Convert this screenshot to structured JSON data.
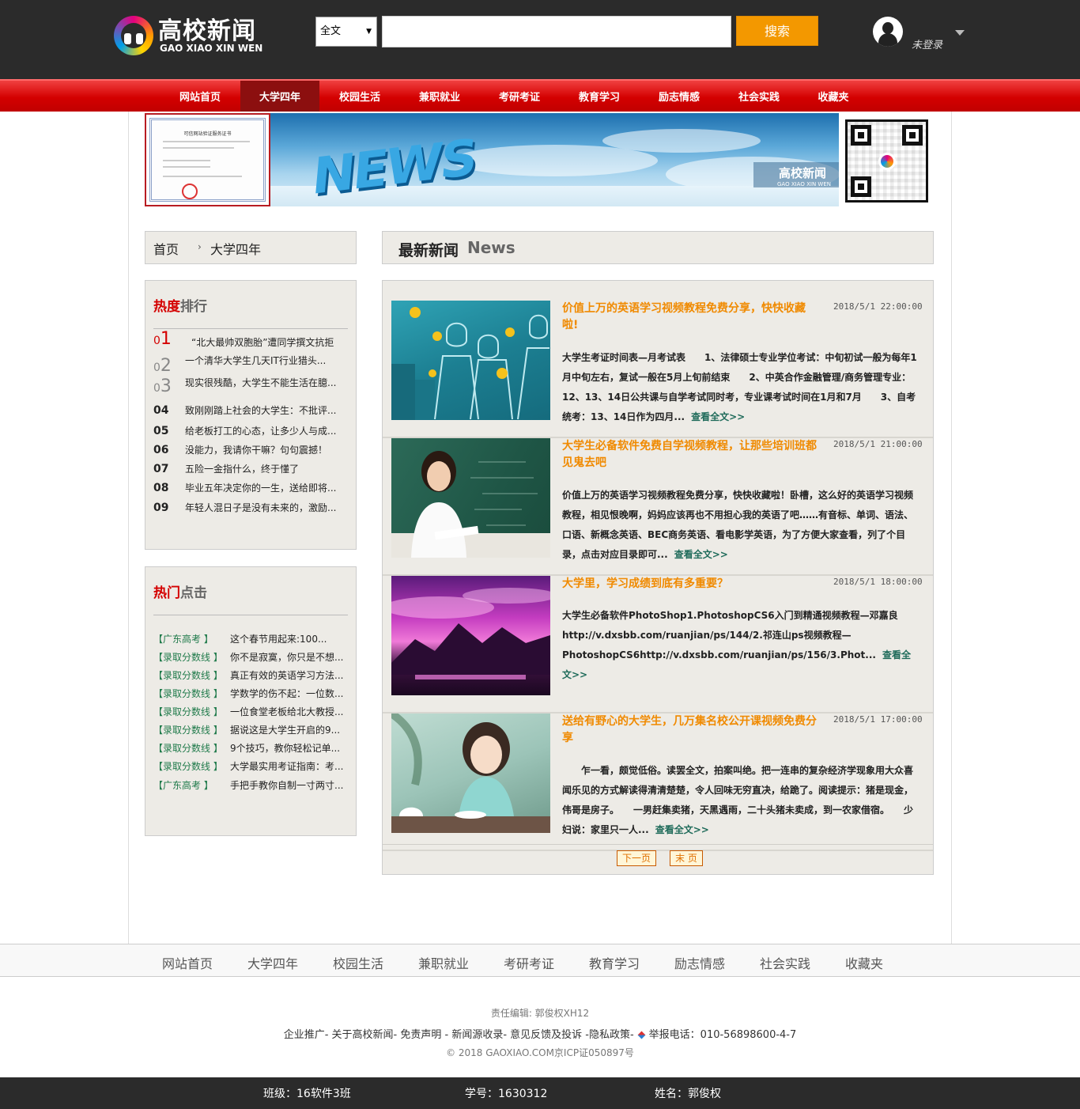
{
  "header": {
    "logo_title": "高校新闻",
    "logo_subtitle": "GAO XIAO XIN WEN",
    "search_scope": "全文",
    "search_placeholder": "",
    "search_button": "搜索",
    "login_status": "未登录"
  },
  "nav": {
    "items": [
      "网站首页",
      "大学四年",
      "校园生活",
      "兼职就业",
      "考研考证",
      "教育学习",
      "励志情感",
      "社会实践",
      "收藏夹"
    ],
    "active": "大学四年"
  },
  "banner": {
    "certificate_title": "可信网站验证服务证书",
    "news_word": "NEWS",
    "tag_title": "高校新闻",
    "tag_subtitle": "GAO XIAO XIN WEN"
  },
  "breadcrumb": {
    "home": "首页",
    "separator": "›",
    "current": "大学四年"
  },
  "ranking": {
    "title_highlight": "热度",
    "title_rest": "排行",
    "items": [
      {
        "num": "1",
        "text": "“北大最帅双胞胎”遭同学撰文抗拒"
      },
      {
        "num": "2",
        "text": "一个清华大学生几天IT行业猎头..."
      },
      {
        "num": "3",
        "text": "现实很残酷，大学生不能生活在臆..."
      },
      {
        "num": "04",
        "text": "致刚刚踏上社会的大学生：不批评..."
      },
      {
        "num": "05",
        "text": "给老板打工的心态，让多少人与成..."
      },
      {
        "num": "06",
        "text": "没能力，我请你干嘛？句句震撼！"
      },
      {
        "num": "07",
        "text": "五险一金指什么，终于懂了"
      },
      {
        "num": "08",
        "text": "毕业五年决定你的一生，送给即将..."
      },
      {
        "num": "09",
        "text": "年轻人混日子是没有未来的，激励..."
      }
    ]
  },
  "hot_clicks": {
    "title_highlight": "热门",
    "title_rest": "点击",
    "items": [
      {
        "tag": "【广东高考 】",
        "text": "这个春节用起来:100..."
      },
      {
        "tag": "【录取分数线 】",
        "text": "你不是寂寞，你只是不想..."
      },
      {
        "tag": "【录取分数线 】",
        "text": "真正有效的英语学习方法..."
      },
      {
        "tag": "【录取分数线 】",
        "text": "学数学的伤不起：一位数..."
      },
      {
        "tag": "【录取分数线 】",
        "text": "一位食堂老板给北大教授..."
      },
      {
        "tag": "【录取分数线 】",
        "text": "据说这是大学生开启的9..."
      },
      {
        "tag": "【录取分数线 】",
        "text": "9个技巧，教你轻松记单..."
      },
      {
        "tag": "【录取分数线 】",
        "text": "大学最实用考证指南：考..."
      },
      {
        "tag": "【广东高考 】",
        "text": "手把手教你自制一寸两寸..."
      }
    ]
  },
  "news": {
    "heading_cn": "最新新闻",
    "heading_en": "News",
    "more_label": "查看全文>>",
    "items": [
      {
        "title": "价值上万的英语学习视频教程免费分享，快快收藏啦!",
        "date": "2018/5/1 22:00:00",
        "body": "大学生考证时间表—月考试表　　1、法律硕士专业学位考试：中旬初试一般为每年1月中旬左右，复试一般在5月上旬前结束　　2、中英合作金融管理/商务管理专业：12、13、14日公共课与自学考试同时考，专业课考试时间在1月和7月　　3、自考统考：13、14日作为四月...",
        "image": "business-illustration"
      },
      {
        "title": "大学生必备软件免费自学视频教程，让那些培训班都见鬼去吧",
        "date": "2018/5/1 21:00:00",
        "body": "价值上万的英语学习视频教程免费分享，快快收藏啦！卧槽，这么好的英语学习视频教程，相见恨晚啊，妈妈应该再也不用担心我的英语了吧……有音标、单词、语法、口语、新概念英语、BEC商务英语、看电影学英语，为了方便大家查看，列了个目录，点击对应目录即可...",
        "image": "teacher-photo"
      },
      {
        "title": "大学里，学习成绩到底有多重要？",
        "date": "2018/5/1 18:00:00",
        "body": "大学生必备软件PhotoShop1.PhotoshopCS6入门到精通视频教程—邓嘉良http://v.dxsbb.com/ruanjian/ps/144/2.祁连山ps视频教程—PhotoshopCS6http://v.dxsbb.com/ruanjian/ps/156/3.Phot...",
        "image": "pink-sky-photo"
      },
      {
        "title": "送给有野心的大学生，几万集名校公开课视频免费分享",
        "date": "2018/5/1 17:00:00",
        "body": "　　乍一看，颇觉低俗。读罢全文，拍案叫绝。把一连串的复杂经济学现象用大众喜闻乐见的方式解读得清清楚楚，令人回味无穷直决，给跪了。阅读提示：猪是现金，伟哥是房子。　　一男赶集卖猪，天黑遇雨，二十头猪未卖成，到一农家借宿。　　少妇说：家里只一人...",
        "image": "girl-tea-photo"
      }
    ],
    "pager": {
      "next": "下一页",
      "last": "末 页"
    }
  },
  "footer": {
    "nav": [
      "网站首页",
      "大学四年",
      "校园生活",
      "兼职就业",
      "考研考证",
      "教育学习",
      "励志情感",
      "社会实践",
      "收藏夹"
    ],
    "editor": "责任编辑: 郭俊权XH12",
    "links": "企业推广- 关于高校新闻- 免责声明 - 新闻源收录- 意见反馈及投诉 -隐私政策-",
    "report": "举报电话：010-56898600-4-7",
    "copyright": "© 2018 GAOXIAO.COM京ICP证050897号",
    "class": "班级：16软件3班",
    "student_id": "学号：1630312",
    "name": "姓名：郭俊权"
  }
}
